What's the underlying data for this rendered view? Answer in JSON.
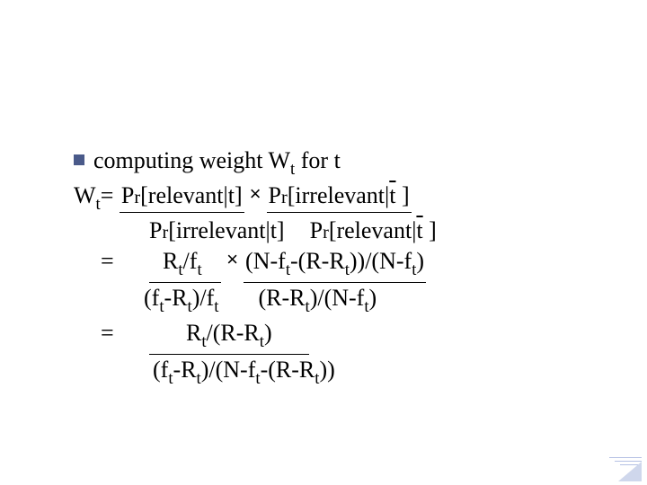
{
  "line1": {
    "prefix": "computing weight W",
    "sub": "t",
    "suffix": " for t"
  },
  "line2": {
    "lhs_W": "W",
    "lhs_sub": "t",
    "eq": "=",
    "n1a": "P",
    "n1b": "r",
    "n1c": "[relevant",
    "n1d": "t]",
    "times": "×",
    "n2a": "P",
    "n2b": "r",
    "n2c": "[irrelevant",
    "n2d": "t",
    "n2e": " ]"
  },
  "line3": {
    "d1a": "P",
    "d1b": "r",
    "d1c": "[irrelevant",
    "d1d": "t]",
    "d2a": "P",
    "d2b": "r",
    "d2c": "[relevant",
    "d2d": "t",
    "d2e": " ]"
  },
  "line4": {
    "eq": "=",
    "n1a": "R",
    "n1b": "t",
    "n1c": "/f",
    "n1d": "t",
    "times": "×",
    "n2a": "(N-f",
    "n2b": "t",
    "n2c": "-(R-R",
    "n2d": "t",
    "n2e": "))/(N-f",
    "n2f": "t",
    "n2g": ")"
  },
  "line5": {
    "d1a": "(f",
    "d1b": "t",
    "d1c": "-R",
    "d1d": "t",
    "d1e": ")/f",
    "d1f": "t",
    "d2a": "(R-R",
    "d2b": "t",
    "d2c": ")/(N-f",
    "d2d": "t",
    "d2e": ")"
  },
  "line6": {
    "eq": "=",
    "na": "R",
    "nb": "t",
    "nc": "/(R-R",
    "nd": "t",
    "ne": ")"
  },
  "line7": {
    "da": "(f",
    "db": "t",
    "dc": "-R",
    "dd": "t",
    "de": ")/(N-f",
    "df": "t",
    "dg": "-(R-R",
    "dh": "t",
    "di": "))"
  }
}
